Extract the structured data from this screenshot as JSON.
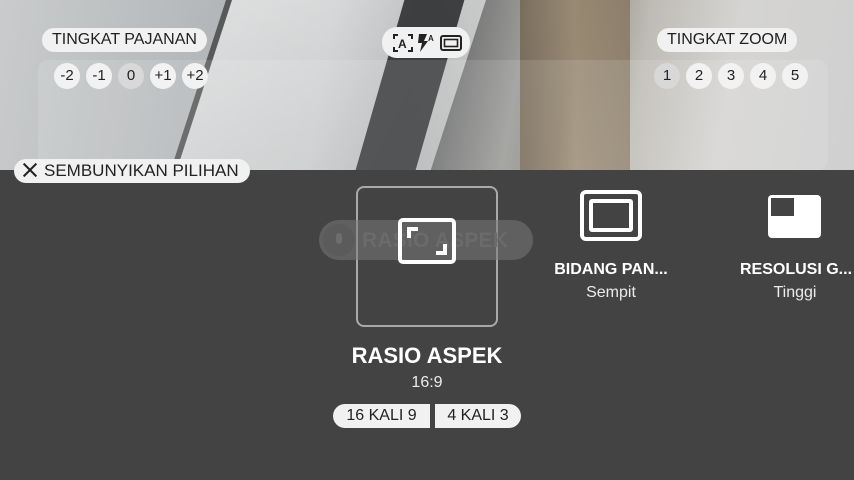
{
  "exposure": {
    "label": "TINGKAT PAJANAN",
    "levels": [
      "-2",
      "-1",
      "0",
      "+1",
      "+2"
    ],
    "selected": "0"
  },
  "zoom": {
    "label": "TINGKAT ZOOM",
    "levels": [
      "1",
      "2",
      "3",
      "4",
      "5"
    ],
    "selected": "1"
  },
  "quick_toggles": {
    "icons": [
      "auto-focus-icon",
      "auto-flash-icon",
      "aspect-frame-icon"
    ],
    "flash_mode_letter": "A"
  },
  "hide_options": {
    "label": "SEMBUNYIKAN PILIHAN"
  },
  "tooltip": {
    "label": "RASIO ASPEK"
  },
  "options": {
    "aspect_ratio": {
      "title": "RASIO ASPEK",
      "value": "16:9",
      "choices": [
        "16 KALI 9",
        "4 KALI 3"
      ]
    },
    "field_of_view": {
      "title": "BIDANG PAN...",
      "value": "Sempit"
    },
    "resolution": {
      "title": "RESOLUSI G...",
      "value": "Tinggi"
    }
  },
  "colors": {
    "panel_bg": "#434343",
    "pill_bg": "#f1f1f1",
    "text_light": "#ffffff"
  }
}
